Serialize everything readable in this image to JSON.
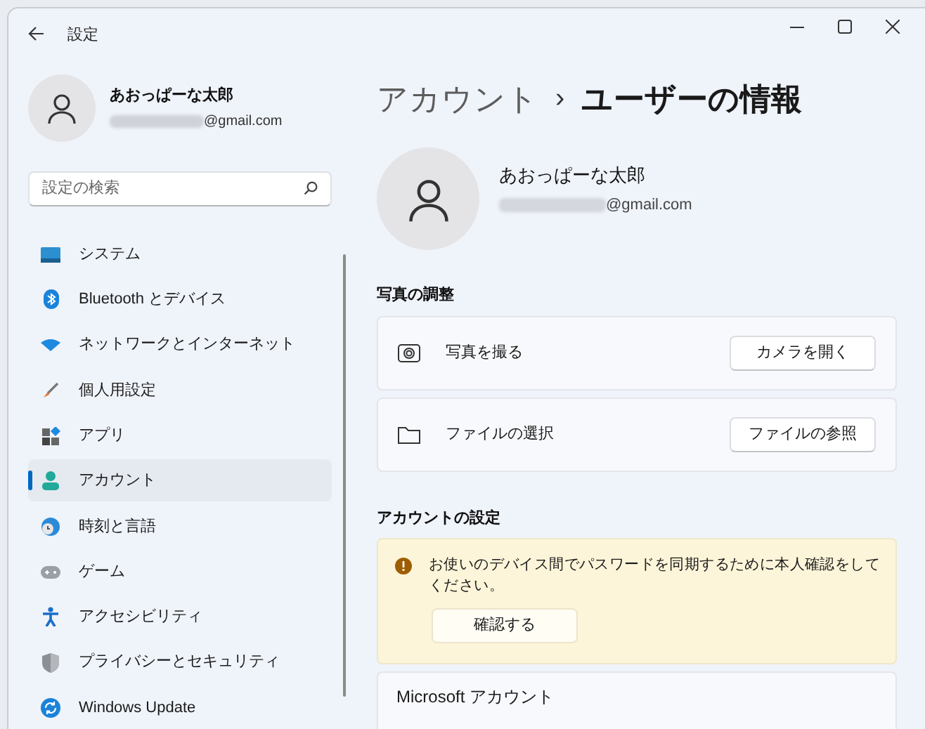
{
  "window": {
    "title": "設定"
  },
  "profile": {
    "name": "あおっぱーな太郎",
    "email": "@gmail.com"
  },
  "search": {
    "placeholder": "設定の検索"
  },
  "sidebar": {
    "items": [
      {
        "label": "システム",
        "kind": "system",
        "selected": false
      },
      {
        "label": "Bluetooth とデバイス",
        "kind": "bluetooth",
        "selected": false
      },
      {
        "label": "ネットワークとインターネット",
        "kind": "network",
        "selected": false
      },
      {
        "label": "個人用設定",
        "kind": "brush",
        "selected": false
      },
      {
        "label": "アプリ",
        "kind": "apps",
        "selected": false
      },
      {
        "label": "アカウント",
        "kind": "account",
        "selected": true
      },
      {
        "label": "時刻と言語",
        "kind": "time",
        "selected": false
      },
      {
        "label": "ゲーム",
        "kind": "game",
        "selected": false
      },
      {
        "label": "アクセシビリティ",
        "kind": "accessibility",
        "selected": false
      },
      {
        "label": "プライバシーとセキュリティ",
        "kind": "privacy",
        "selected": false
      },
      {
        "label": "Windows Update",
        "kind": "update",
        "selected": false
      }
    ]
  },
  "breadcrumb": {
    "parent": "アカウント",
    "separator": "›",
    "current": "ユーザーの情報"
  },
  "user": {
    "name": "あおっぱーな太郎",
    "email": "@gmail.com"
  },
  "photo_section": {
    "title": "写真の調整",
    "rows": [
      {
        "kind": "camera",
        "label": "写真を撮る",
        "button": "カメラを開く"
      },
      {
        "kind": "folder",
        "label": "ファイルの選択",
        "button": "ファイルの参照"
      }
    ]
  },
  "account_section": {
    "title": "アカウントの設定",
    "warning": {
      "message": "お使いのデバイス間でパスワードを同期するために本人確認をしてください。",
      "button": "確認する"
    },
    "microsoft": {
      "title": "Microsoft アカウント"
    }
  }
}
